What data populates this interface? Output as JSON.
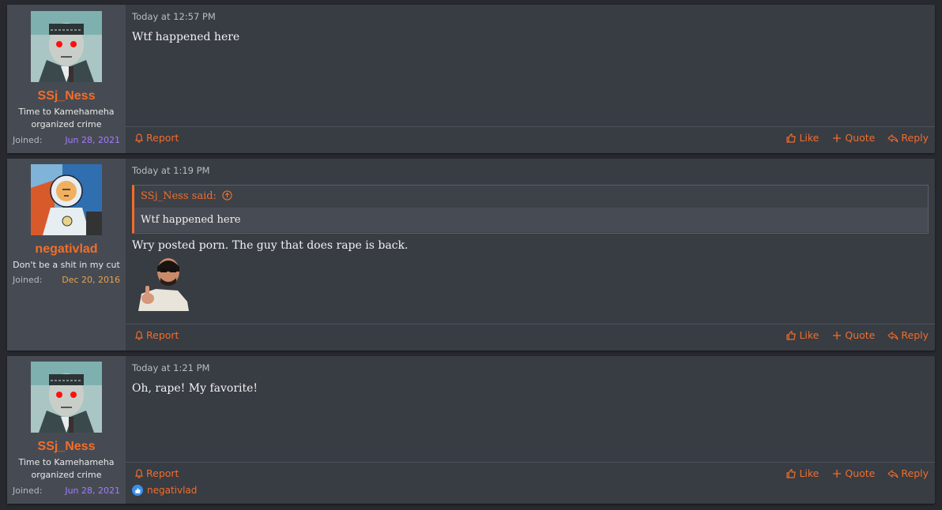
{
  "posts": [
    {
      "username": "SSj_Ness",
      "user_title_1": "Time to Kamehameha",
      "user_title_2": "organized crime",
      "joined_label": "Joined:",
      "joined_date": "Jun 28, 2021",
      "timestamp": "Today at 12:57 PM",
      "body": "Wtf happened here",
      "report": "Report",
      "like": "Like",
      "quote": "Quote",
      "reply": "Reply"
    },
    {
      "username": "negativlad",
      "user_title_1": "Don't be a shit in my cut",
      "joined_label": "Joined:",
      "joined_date": "Dec 20, 2016",
      "timestamp": "Today at 1:19 PM",
      "quote_author": "SSj_Ness said:",
      "quote_text": "Wtf happened here",
      "body": "Wry posted porn. The guy that does rape is back.",
      "report": "Report",
      "like": "Like",
      "quote": "Quote",
      "reply": "Reply"
    },
    {
      "username": "SSj_Ness",
      "user_title_1": "Time to Kamehameha",
      "user_title_2": "organized crime",
      "joined_label": "Joined:",
      "joined_date": "Jun 28, 2021",
      "timestamp": "Today at 1:21 PM",
      "body": "Oh, rape! My favorite!",
      "report": "Report",
      "like": "Like",
      "quote": "Quote",
      "reply": "Reply",
      "reaction_user": "negativlad"
    }
  ],
  "colors": {
    "accent": "#f26d2b",
    "post_bg": "#383c43",
    "user_cell_bg": "#464b53",
    "date_purple": "#a47bff",
    "date_orange": "#e8a24a"
  },
  "icons": [
    "bell-icon",
    "thumbs-up-icon",
    "plus-icon",
    "reply-arrow-icon",
    "arrow-up-circle-icon",
    "like-reaction-icon"
  ]
}
